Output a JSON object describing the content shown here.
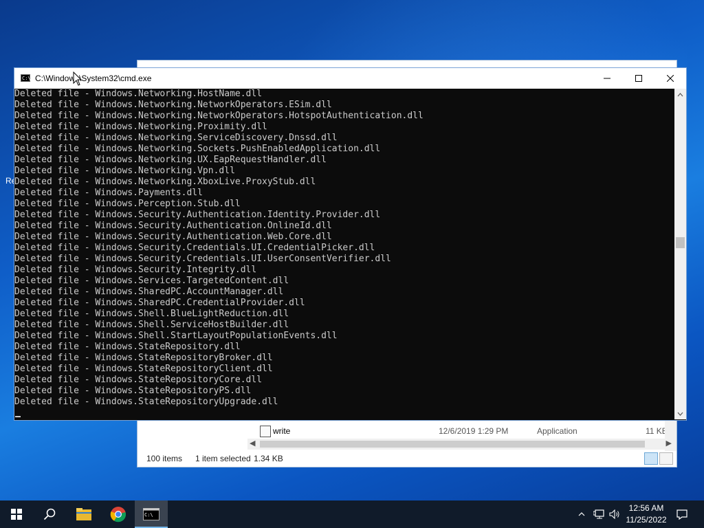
{
  "desktop": {
    "partial_label": "Re"
  },
  "explorer": {
    "visible_row": {
      "name": "write",
      "date": "12/6/2019 1:29 PM",
      "type": "Application",
      "size": "11 KB"
    },
    "status": {
      "items": "100 items",
      "selected": "1 item selected",
      "size": "1.34 KB"
    }
  },
  "cmd": {
    "title": "C:\\Windows\\System32\\cmd.exe",
    "lines": [
      "Deleted file - Windows.Networking.HostName.dll",
      "Deleted file - Windows.Networking.NetworkOperators.ESim.dll",
      "Deleted file - Windows.Networking.NetworkOperators.HotspotAuthentication.dll",
      "Deleted file - Windows.Networking.Proximity.dll",
      "Deleted file - Windows.Networking.ServiceDiscovery.Dnssd.dll",
      "Deleted file - Windows.Networking.Sockets.PushEnabledApplication.dll",
      "Deleted file - Windows.Networking.UX.EapRequestHandler.dll",
      "Deleted file - Windows.Networking.Vpn.dll",
      "Deleted file - Windows.Networking.XboxLive.ProxyStub.dll",
      "Deleted file - Windows.Payments.dll",
      "Deleted file - Windows.Perception.Stub.dll",
      "Deleted file - Windows.Security.Authentication.Identity.Provider.dll",
      "Deleted file - Windows.Security.Authentication.OnlineId.dll",
      "Deleted file - Windows.Security.Authentication.Web.Core.dll",
      "Deleted file - Windows.Security.Credentials.UI.CredentialPicker.dll",
      "Deleted file - Windows.Security.Credentials.UI.UserConsentVerifier.dll",
      "Deleted file - Windows.Security.Integrity.dll",
      "Deleted file - Windows.Services.TargetedContent.dll",
      "Deleted file - Windows.SharedPC.AccountManager.dll",
      "Deleted file - Windows.SharedPC.CredentialProvider.dll",
      "Deleted file - Windows.Shell.BlueLightReduction.dll",
      "Deleted file - Windows.Shell.ServiceHostBuilder.dll",
      "Deleted file - Windows.Shell.StartLayoutPopulationEvents.dll",
      "Deleted file - Windows.StateRepository.dll",
      "Deleted file - Windows.StateRepositoryBroker.dll",
      "Deleted file - Windows.StateRepositoryClient.dll",
      "Deleted file - Windows.StateRepositoryCore.dll",
      "Deleted file - Windows.StateRepositoryPS.dll",
      "Deleted file - Windows.StateRepositoryUpgrade.dll"
    ]
  },
  "taskbar": {
    "items": [
      "start-icon",
      "search-icon",
      "file-explorer-icon",
      "chrome-icon",
      "cmd-icon"
    ],
    "active_item": "cmd-icon",
    "clock": {
      "time": "12:56 AM",
      "date": "11/25/2022"
    }
  }
}
